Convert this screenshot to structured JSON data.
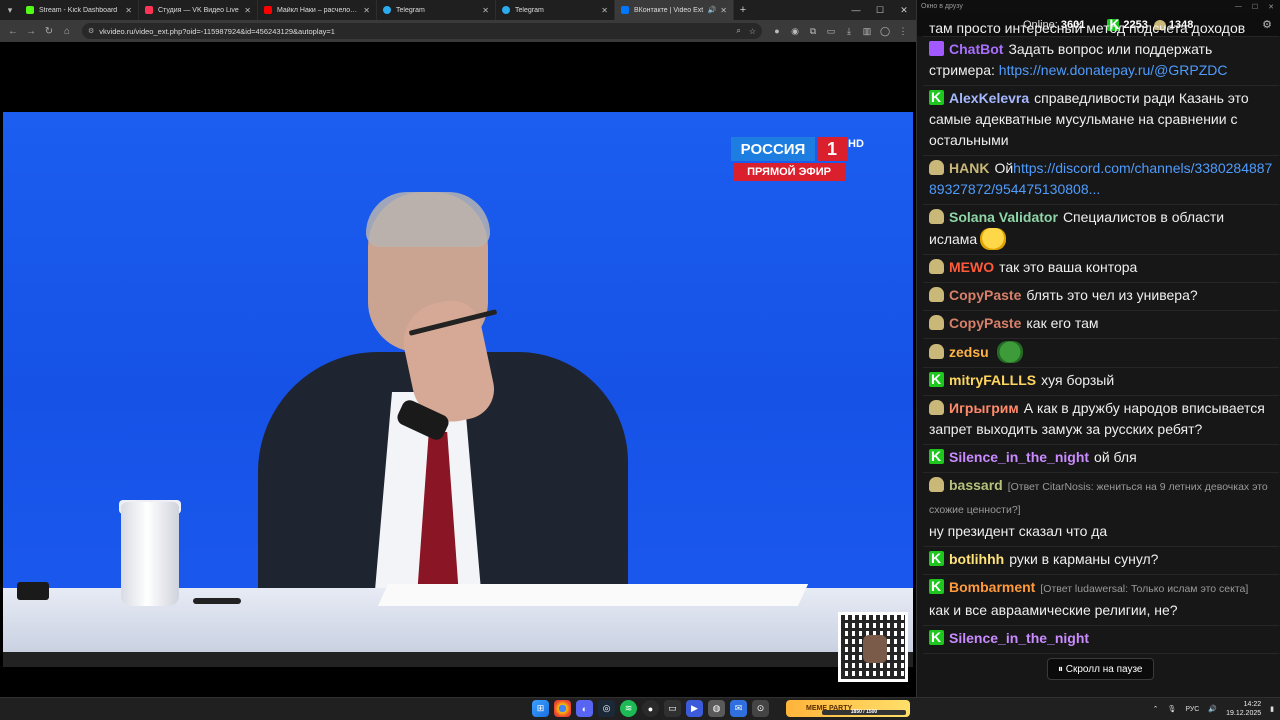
{
  "browser": {
    "tabs": [
      {
        "title": "Stream - Kick Dashboard",
        "color": "#53fc18",
        "active": false
      },
      {
        "title": "Студия — VK Видео Live",
        "color": "#ff3355",
        "active": false
      },
      {
        "title": "Майкл Наки – расчеловечивание",
        "color": "#ff0000",
        "active": false
      },
      {
        "title": "Telegram",
        "color": "#2aabee",
        "active": false
      },
      {
        "title": "Telegram",
        "color": "#2aabee",
        "active": false
      },
      {
        "title": "ВКонтакте | Video Ext",
        "color": "#0077ff",
        "active": true
      }
    ],
    "url": "vkvideo.ru/video_ext.php?oid=-115987924&id=456243129&autoplay=1"
  },
  "video": {
    "logo_top": "РОССИЯ",
    "logo_number": "1",
    "logo_hd": "HD",
    "logo_live": "ПРЯМОЙ ЭФИР"
  },
  "chat": {
    "window_title": "Окно в друзу",
    "online_label": "Online:",
    "online_value": "3601",
    "kick_count": "2253",
    "gold_count": "1348",
    "top_partial": "там просто интересный метод подсчета доходов",
    "messages": [
      {
        "badge": "bot",
        "user": "ChatBot",
        "color": "#a970ff",
        "text": "Задать вопрос или поддержать стримера: ",
        "link": "https://new.donatepay.ru/@GRPZDC"
      },
      {
        "badge": "kick",
        "user": "AlexKelevra",
        "color": "#a5b8ff",
        "text": "справедливости ради Казань это самые адекватные мусульмане на сравнении с остальными"
      },
      {
        "badge": "gold",
        "user": "HANK",
        "color": "#c9b877",
        "text": "Ой",
        "link": "https://discord.com/channels/338028488789327872/954475130808..."
      },
      {
        "badge": "gold",
        "user": "Solana Validator",
        "color": "#8ed6a8",
        "text": "Специалистов в области ислама",
        "emote": "laugh"
      },
      {
        "badge": "gold",
        "user": "MEWO",
        "color": "#ff5a3a",
        "text": "так это ваша контора"
      },
      {
        "badge": "gold",
        "user": "CopyPaste",
        "color": "#d8806a",
        "text": "блять это чел из универа?"
      },
      {
        "badge": "gold",
        "user": "CopyPaste",
        "color": "#d8806a",
        "text": "как его там"
      },
      {
        "badge": "gold",
        "user": "zedsu",
        "color": "#ffb347",
        "text": "",
        "emote": "frog"
      },
      {
        "badge": "kick",
        "user": "mitryFALLLS",
        "color": "#ffd75e",
        "text": "хуя борзый"
      },
      {
        "badge": "gold",
        "user": "Игрыгрим",
        "color": "#ff8b6b",
        "text": "А как в дружбу народов вписывается запрет выходить замуж за русских ребят?"
      },
      {
        "badge": "kick",
        "user": "Silence_in_the_night",
        "color": "#c98bff",
        "text": "ой бля"
      },
      {
        "badge": "gold",
        "user": "bassard",
        "color": "#b5c27a",
        "reply": "[Ответ CitarNosis: жениться на 9 летних девочках это схожие ценности?]",
        "text": "ну президент сказал что да"
      },
      {
        "badge": "kick",
        "user": "botlihhh",
        "color": "#ffe27a",
        "text": "руки в карманы сунул?"
      },
      {
        "badge": "kick",
        "user": "Bombarment",
        "color": "#ff9a3c",
        "reply": "[Ответ ludawersal: Только ислам это секта]",
        "text": "как и все авраамические религии, не?"
      },
      {
        "badge": "kick",
        "user": "Silence_in_the_night",
        "color": "#c98bff",
        "text": ""
      }
    ],
    "pause_label": "⏸ Скролл на паузе"
  },
  "taskbar": {
    "meme_title": "MEME PARTY",
    "meme_progress": "1850 / 1500",
    "lang": "РУС",
    "time": "14:22",
    "date": "19.12.2025"
  }
}
